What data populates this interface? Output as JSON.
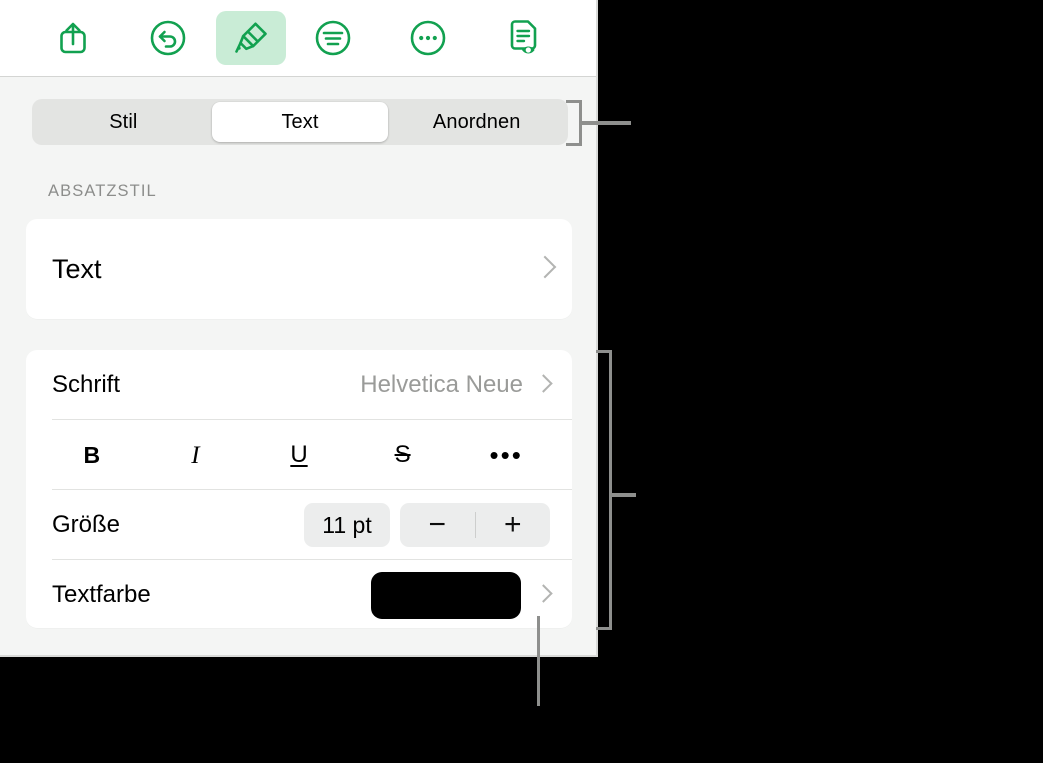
{
  "app": {
    "accent_color": "#12a150",
    "accent_bg_active": "#c9ecd6",
    "panel_bg": "#f4f5f4",
    "card_bg": "#ffffff",
    "canvas_bg": "#000000"
  },
  "toolbar": {
    "buttons": [
      {
        "name": "share-icon",
        "label": "Share"
      },
      {
        "name": "undo-icon",
        "label": "Undo"
      },
      {
        "name": "brush-icon",
        "label": "Format",
        "active": true
      },
      {
        "name": "insert-icon",
        "label": "Insert"
      },
      {
        "name": "more-icon",
        "label": "More"
      },
      {
        "name": "document-view-icon",
        "label": "Document Options"
      }
    ]
  },
  "segmented_control": {
    "options": [
      "Stil",
      "Text",
      "Anordnen"
    ],
    "selected": "Text",
    "selected_index": 1
  },
  "sections": {
    "paragraph_style": {
      "header": "ABSATZSTIL",
      "value": "Text"
    },
    "font": {
      "font_row": {
        "label": "Schrift",
        "value": "Helvetica Neue"
      },
      "style_buttons": [
        {
          "name": "bold-button",
          "label": "B"
        },
        {
          "name": "italic-button",
          "label": "I"
        },
        {
          "name": "underline-button",
          "label": "U"
        },
        {
          "name": "strikethrough-button",
          "label": "S"
        },
        {
          "name": "more-text-options-button",
          "label": "•••"
        }
      ],
      "size_row": {
        "label": "Größe",
        "value": "11 pt",
        "decrement": "−",
        "increment": "+"
      },
      "text_color_row": {
        "label": "Textfarbe",
        "swatch_color": "#000000"
      }
    }
  }
}
